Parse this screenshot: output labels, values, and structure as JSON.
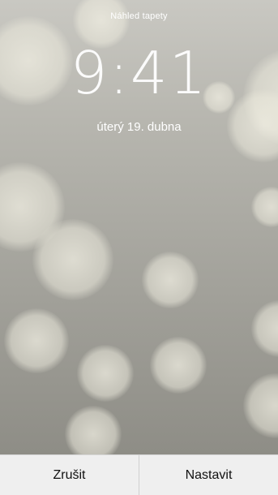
{
  "header": {
    "title": "Náhled tapety"
  },
  "lockscreen": {
    "time": "9:41",
    "date": "úterý 19. dubna"
  },
  "toolbar": {
    "cancel_label": "Zrušit",
    "set_label": "Nastavit"
  },
  "colors": {
    "toolbar_bg": "#efefef",
    "wallpaper_top": "#c9c8c2",
    "wallpaper_bottom": "#8e8d86"
  }
}
